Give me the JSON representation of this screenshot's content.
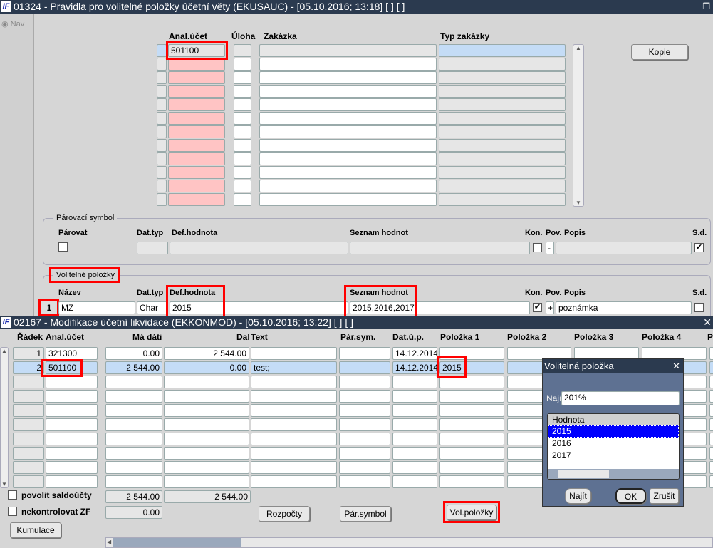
{
  "top_window": {
    "title": "01324 - Pravidla pro volitelné položky účetní věty (EKUSAUC) - [05.10.2016; 13:18]  [ ]  [ ]",
    "nav_label": "Nav",
    "columns": [
      "Anal.účet",
      "Úloha",
      "Zakázka",
      "Typ zakázky"
    ],
    "rows": [
      {
        "anal": "501100",
        "uloha": "",
        "zakazka": "",
        "typ": ""
      }
    ],
    "row_count": 12,
    "kopie_button": "Kopie",
    "parovaci": {
      "legend": "Párovací symbol",
      "headers": {
        "parovat": "Párovat",
        "dattyp": "Dat.typ",
        "defhod": "Def.hodnota",
        "seznam": "Seznam hodnot",
        "kon": "Kon.",
        "pov": "Pov.",
        "popis": "Popis",
        "sd": "S.d."
      },
      "pov_value": "-",
      "sd_checked": true
    },
    "volitelne": {
      "legend": "Volitelné položky",
      "headers": {
        "nazev": "Název",
        "dattyp": "Dat.typ",
        "defhod": "Def.hodnota",
        "seznam": "Seznam hodnot",
        "kon": "Kon.",
        "pov": "Pov.",
        "popis": "Popis",
        "sd": "S.d."
      },
      "row": {
        "index": "1",
        "nazev": "MZ",
        "dattyp": "Char",
        "defhod": "2015",
        "seznam": "2015,2016,2017",
        "kon_checked": true,
        "pov": "+",
        "popis": "poznámka"
      }
    }
  },
  "bottom_window": {
    "title": "02167 - Modifikace účetní likvidace (EKKONMOD) - [05.10.2016; 13:22]  [ ]  [ ]",
    "columns": [
      "Řádek",
      "Anal.účet",
      "Má dáti",
      "Dal",
      "Text",
      "Pár.sym.",
      "Dat.ú.p.",
      "Položka 1",
      "Položka 2",
      "Položka 3",
      "Položka 4",
      "P"
    ],
    "rows": [
      {
        "radek": "1",
        "anal": "321300",
        "madati": "0.00",
        "dal": "2 544.00",
        "text": "",
        "parsym": "",
        "datup": "14.12.2014",
        "pol1": ""
      },
      {
        "radek": "2",
        "anal": "501100",
        "madati": "2 544.00",
        "dal": "0.00",
        "text": "test;",
        "parsym": "",
        "datup": "14.12.2014",
        "pol1": "2015"
      }
    ],
    "row_count": 10,
    "povolit_saldoucty": "povolit saldoúčty",
    "nekontrolovat_zf": "nekontrolovat ZF",
    "sum_madati": "2 544.00",
    "sum_dal": "2 544.00",
    "diff": "0.00",
    "buttons": {
      "kumulace": "Kumulace",
      "rozpocty": "Rozpočty",
      "parsymbol": "Pár.symbol",
      "volpolozky": "Vol.položky"
    }
  },
  "popup": {
    "title": "Volitelná položka",
    "search_label": "Najít",
    "search_value": "201%",
    "list_header": "Hodnota",
    "items": [
      "2015",
      "2016",
      "2017"
    ],
    "selected_index": 0,
    "buttons": {
      "find": "Najít",
      "ok": "OK",
      "cancel": "Zrušit"
    }
  }
}
